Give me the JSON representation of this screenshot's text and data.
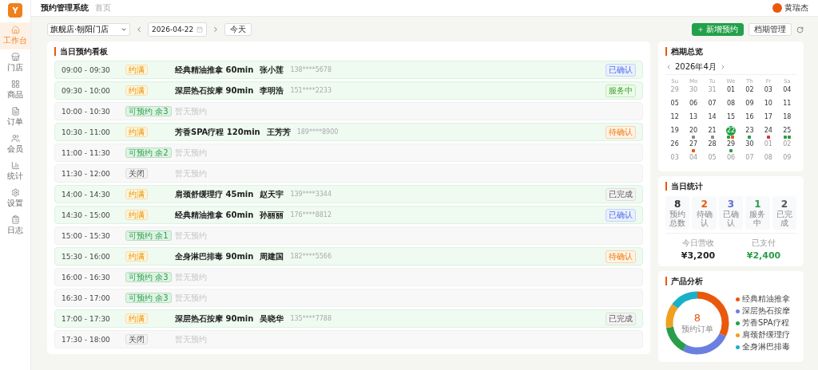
{
  "app": {
    "logo": "Y",
    "title": "预约管理系统",
    "breadcrumb": "首页",
    "user": {
      "name": "黄瑞杰"
    }
  },
  "sidebar": {
    "items": [
      {
        "label": "工作台",
        "selected": true
      },
      {
        "label": "门店",
        "selected": false
      },
      {
        "label": "商品",
        "selected": false
      },
      {
        "label": "订单",
        "selected": false
      },
      {
        "label": "会员",
        "selected": false
      },
      {
        "label": "统计",
        "selected": false
      },
      {
        "label": "设置",
        "selected": false
      },
      {
        "label": "日志",
        "selected": false
      }
    ]
  },
  "toolbar": {
    "store": "旗舰店·朝阳门店",
    "date": "2026-04-22",
    "today_button": "今天",
    "new_button": "新增预约",
    "schedule_button": "档期管理"
  },
  "board": {
    "title": "当日预约看板",
    "slots": [
      {
        "time": "09:00 - 09:30",
        "kind": "booked",
        "tag": "约满",
        "service": "经典精油推拿 60min",
        "customer": "张小莲",
        "phone": "138****5678",
        "status": {
          "label": "已确认",
          "kind": "confirmed"
        }
      },
      {
        "time": "09:30 - 10:00",
        "kind": "booked",
        "tag": "约满",
        "service": "深层热石按摩 90min",
        "customer": "李明浩",
        "phone": "151****2233",
        "status": {
          "label": "服务中",
          "kind": "serving"
        }
      },
      {
        "time": "10:00 - 10:30",
        "kind": "open",
        "tag": "可预约 余3",
        "empty": "暂无预约"
      },
      {
        "time": "10:30 - 11:00",
        "kind": "booked",
        "tag": "约满",
        "service": "芳香SPA疗程 120min",
        "customer": "王芳芳",
        "phone": "189****8900",
        "status": {
          "label": "待确认",
          "kind": "pending"
        }
      },
      {
        "time": "11:00 - 11:30",
        "kind": "open",
        "tag": "可预约 余2",
        "empty": "暂无预约"
      },
      {
        "time": "11:30 - 12:00",
        "kind": "closed",
        "tag": "关闭",
        "empty": "暂无预约"
      },
      {
        "time": "14:00 - 14:30",
        "kind": "booked",
        "tag": "约满",
        "service": "肩颈舒缓理疗 45min",
        "customer": "赵天宇",
        "phone": "139****3344",
        "status": {
          "label": "已完成",
          "kind": "done"
        }
      },
      {
        "time": "14:30 - 15:00",
        "kind": "booked",
        "tag": "约满",
        "service": "经典精油推拿 60min",
        "customer": "孙丽丽",
        "phone": "176****8812",
        "status": {
          "label": "已确认",
          "kind": "confirmed"
        }
      },
      {
        "time": "15:00 - 15:30",
        "kind": "open",
        "tag": "可预约 余1",
        "empty": "暂无预约"
      },
      {
        "time": "15:30 - 16:00",
        "kind": "booked",
        "tag": "约满",
        "service": "全身淋巴排毒 90min",
        "customer": "周建国",
        "phone": "182****5566",
        "status": {
          "label": "待确认",
          "kind": "pending"
        }
      },
      {
        "time": "16:00 - 16:30",
        "kind": "open",
        "tag": "可预约 余3",
        "empty": "暂无预约"
      },
      {
        "time": "16:30 - 17:00",
        "kind": "open",
        "tag": "可预约 余3",
        "empty": "暂无预约"
      },
      {
        "time": "17:00 - 17:30",
        "kind": "booked",
        "tag": "约满",
        "service": "深层热石按摩 90min",
        "customer": "吴晓华",
        "phone": "135****7788",
        "status": {
          "label": "已完成",
          "kind": "done"
        }
      },
      {
        "time": "17:30 - 18:00",
        "kind": "closed",
        "tag": "关闭",
        "empty": "暂无预约"
      }
    ]
  },
  "calendar": {
    "title": "档期总览",
    "month": "2026年4月",
    "weekdays": [
      "Su",
      "Mo",
      "Tu",
      "We",
      "Th",
      "Fr",
      "Sa"
    ],
    "weeks": [
      [
        {
          "day": "29",
          "muted": true,
          "selected": false
        },
        {
          "day": "30",
          "muted": true,
          "selected": false
        },
        {
          "day": "31",
          "muted": true,
          "selected": false
        },
        {
          "day": "01",
          "muted": false,
          "selected": false
        },
        {
          "day": "02",
          "muted": false,
          "selected": false
        },
        {
          "day": "03",
          "muted": false,
          "selected": false
        },
        {
          "day": "04",
          "muted": false,
          "selected": false
        }
      ],
      [
        {
          "day": "05",
          "muted": false,
          "selected": false
        },
        {
          "day": "06",
          "muted": false,
          "selected": false
        },
        {
          "day": "07",
          "muted": false,
          "selected": false
        },
        {
          "day": "08",
          "muted": false,
          "selected": false
        },
        {
          "day": "09",
          "muted": false,
          "selected": false
        },
        {
          "day": "10",
          "muted": false,
          "selected": false
        },
        {
          "day": "11",
          "muted": false,
          "selected": false
        }
      ],
      [
        {
          "day": "12",
          "muted": false,
          "selected": false
        },
        {
          "day": "13",
          "muted": false,
          "selected": false
        },
        {
          "day": "14",
          "muted": false,
          "selected": false
        },
        {
          "day": "15",
          "muted": false,
          "selected": false
        },
        {
          "day": "16",
          "muted": false,
          "selected": false
        },
        {
          "day": "17",
          "muted": false,
          "selected": false
        },
        {
          "day": "18",
          "muted": false,
          "selected": false
        }
      ],
      [
        {
          "day": "19",
          "muted": false,
          "selected": false
        },
        {
          "day": "20",
          "muted": false,
          "selected": false,
          "dots": [
            {
              "color": "#8a8a8a"
            }
          ]
        },
        {
          "day": "21",
          "muted": false,
          "selected": false,
          "dots": [
            {
              "color": "#8a8a8a"
            }
          ]
        },
        {
          "day": "22",
          "muted": false,
          "selected": true,
          "dots": [
            {
              "color": "#2a9d4a"
            },
            {
              "color": "#e8590c"
            }
          ]
        },
        {
          "day": "23",
          "muted": false,
          "selected": false,
          "dots": [
            {
              "color": "#2a9d4a"
            }
          ]
        },
        {
          "day": "24",
          "muted": false,
          "selected": false,
          "dots": [
            {
              "color": "#e03131"
            }
          ]
        },
        {
          "day": "25",
          "muted": false,
          "selected": false,
          "dots": [
            {
              "color": "#2a9d4a"
            },
            {
              "color": "#2a9d4a"
            }
          ]
        }
      ],
      [
        {
          "day": "26",
          "muted": false,
          "selected": false
        },
        {
          "day": "27",
          "muted": false,
          "selected": false,
          "dots": [
            {
              "color": "#e8590c"
            }
          ]
        },
        {
          "day": "28",
          "muted": false,
          "selected": false
        },
        {
          "day": "29",
          "muted": false,
          "selected": false,
          "dots": [
            {
              "color": "#2a9d4a"
            }
          ]
        },
        {
          "day": "30",
          "muted": false,
          "selected": false
        },
        {
          "day": "01",
          "muted": true,
          "selected": false
        },
        {
          "day": "02",
          "muted": true,
          "selected": false
        }
      ],
      [
        {
          "day": "03",
          "muted": true,
          "selected": false
        },
        {
          "day": "04",
          "muted": true,
          "selected": false
        },
        {
          "day": "05",
          "muted": true,
          "selected": false
        },
        {
          "day": "06",
          "muted": true,
          "selected": false
        },
        {
          "day": "07",
          "muted": true,
          "selected": false
        },
        {
          "day": "08",
          "muted": true,
          "selected": false
        },
        {
          "day": "09",
          "muted": true,
          "selected": false
        }
      ]
    ]
  },
  "stats": {
    "title": "当日统计",
    "counts": [
      {
        "value": "8",
        "label": "预约总数",
        "color": "#333333"
      },
      {
        "value": "2",
        "label": "待确认",
        "color": "#e8590c"
      },
      {
        "value": "3",
        "label": "已确认",
        "color": "#5c6fd6"
      },
      {
        "value": "1",
        "label": "服务中",
        "color": "#2a9d4a"
      },
      {
        "value": "2",
        "label": "已完成",
        "color": "#555555"
      }
    ],
    "revenue": [
      {
        "label": "今日营收",
        "value": "¥3,200",
        "color": "#222222"
      },
      {
        "label": "已支付",
        "value": "¥2,400",
        "color": "#2a9d4a"
      }
    ]
  },
  "products": {
    "title": "产品分析",
    "total": "8",
    "total_label": "预约订单",
    "legend": [
      {
        "name": "经典精油推拿",
        "color": "#e8590c"
      },
      {
        "name": "深层热石按摩",
        "color": "#6b7fe0"
      },
      {
        "name": "芳香SPA疗程",
        "color": "#2a9d4a"
      },
      {
        "name": "肩颈舒缓理疗",
        "color": "#f0a020"
      },
      {
        "name": "全身淋巴排毒",
        "color": "#1ab0c8"
      }
    ]
  }
}
